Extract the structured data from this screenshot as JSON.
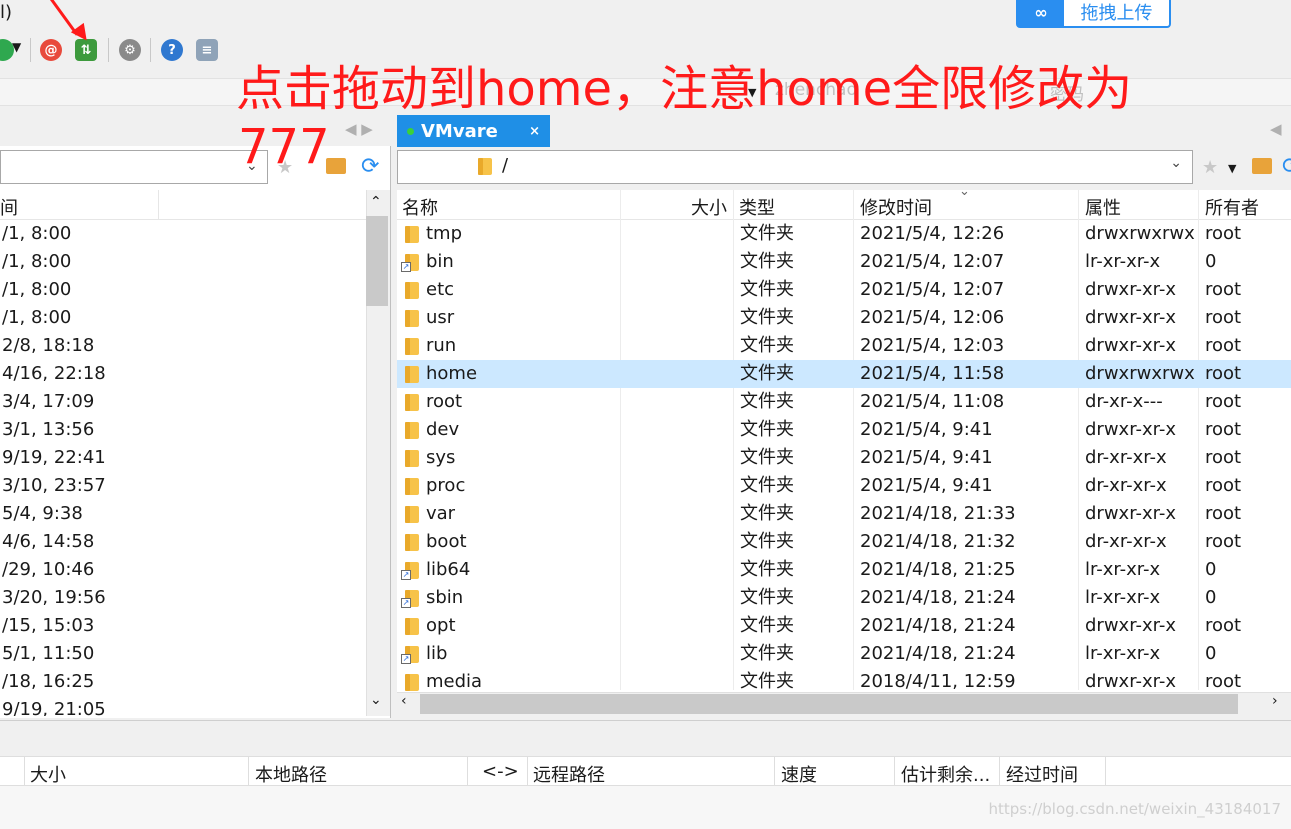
{
  "menu": {
    "fragment": "l)"
  },
  "upload": {
    "label": "拖拽上传"
  },
  "address_strip": {
    "user": "zhenchao",
    "code_label": "密码"
  },
  "annotation": {
    "line1": "点击拖动到home，注意home全限修改为",
    "line2": "777"
  },
  "left_pane": {
    "header": "间",
    "rows": [
      "/1, 8:00",
      "/1, 8:00",
      "/1, 8:00",
      "/1, 8:00",
      "2/8, 18:18",
      "4/16, 22:18",
      "3/4, 17:09",
      "3/1, 13:56",
      "9/19, 22:41",
      "3/10, 23:57",
      "5/4, 9:38",
      "4/6, 14:58",
      "/29, 10:46",
      "3/20, 19:56",
      "/15, 15:03",
      "5/1, 11:50",
      "/18, 16:25",
      "9/19, 21:05"
    ]
  },
  "remote_tab": {
    "label": "VMvare",
    "close": "×"
  },
  "remote_path": {
    "value": "/"
  },
  "columns": {
    "name": "名称",
    "size": "大小",
    "type": "类型",
    "mtime": "修改时间",
    "attr": "属性",
    "owner": "所有者"
  },
  "files": [
    {
      "name": "tmp",
      "type": "文件夹",
      "mtime": "2021/5/4, 12:26",
      "attr": "drwxrwxrwx",
      "owner": "root",
      "link": false
    },
    {
      "name": "bin",
      "type": "文件夹",
      "mtime": "2021/5/4, 12:07",
      "attr": "lr-xr-xr-x",
      "owner": "0",
      "link": true
    },
    {
      "name": "etc",
      "type": "文件夹",
      "mtime": "2021/5/4, 12:07",
      "attr": "drwxr-xr-x",
      "owner": "root",
      "link": false
    },
    {
      "name": "usr",
      "type": "文件夹",
      "mtime": "2021/5/4, 12:06",
      "attr": "drwxr-xr-x",
      "owner": "root",
      "link": false
    },
    {
      "name": "run",
      "type": "文件夹",
      "mtime": "2021/5/4, 12:03",
      "attr": "drwxr-xr-x",
      "owner": "root",
      "link": false
    },
    {
      "name": "home",
      "type": "文件夹",
      "mtime": "2021/5/4, 11:58",
      "attr": "drwxrwxrwx",
      "owner": "root",
      "link": false,
      "selected": true
    },
    {
      "name": "root",
      "type": "文件夹",
      "mtime": "2021/5/4, 11:08",
      "attr": "dr-xr-x---",
      "owner": "root",
      "link": false
    },
    {
      "name": "dev",
      "type": "文件夹",
      "mtime": "2021/5/4, 9:41",
      "attr": "drwxr-xr-x",
      "owner": "root",
      "link": false
    },
    {
      "name": "sys",
      "type": "文件夹",
      "mtime": "2021/5/4, 9:41",
      "attr": "dr-xr-xr-x",
      "owner": "root",
      "link": false
    },
    {
      "name": "proc",
      "type": "文件夹",
      "mtime": "2021/5/4, 9:41",
      "attr": "dr-xr-xr-x",
      "owner": "root",
      "link": false
    },
    {
      "name": "var",
      "type": "文件夹",
      "mtime": "2021/4/18, 21:33",
      "attr": "drwxr-xr-x",
      "owner": "root",
      "link": false
    },
    {
      "name": "boot",
      "type": "文件夹",
      "mtime": "2021/4/18, 21:32",
      "attr": "dr-xr-xr-x",
      "owner": "root",
      "link": false
    },
    {
      "name": "lib64",
      "type": "文件夹",
      "mtime": "2021/4/18, 21:25",
      "attr": "lr-xr-xr-x",
      "owner": "0",
      "link": true
    },
    {
      "name": "sbin",
      "type": "文件夹",
      "mtime": "2021/4/18, 21:24",
      "attr": "lr-xr-xr-x",
      "owner": "0",
      "link": true
    },
    {
      "name": "opt",
      "type": "文件夹",
      "mtime": "2021/4/18, 21:24",
      "attr": "drwxr-xr-x",
      "owner": "root",
      "link": false
    },
    {
      "name": "lib",
      "type": "文件夹",
      "mtime": "2021/4/18, 21:24",
      "attr": "lr-xr-xr-x",
      "owner": "0",
      "link": true
    },
    {
      "name": "media",
      "type": "文件夹",
      "mtime": "2018/4/11, 12:59",
      "attr": "drwxr-xr-x",
      "owner": "root",
      "link": false
    }
  ],
  "queue_columns": {
    "size": "大小",
    "local": "本地路径",
    "dir": "<->",
    "remote": "远程路径",
    "speed": "速度",
    "eta": "估计剩余...",
    "elapsed": "经过时间"
  },
  "watermark": "https://blog.csdn.net/weixin_43184017",
  "colors": {
    "accent": "#1f8fe6",
    "annotation": "#ff1a1a",
    "selected_row": "#cce8ff"
  }
}
